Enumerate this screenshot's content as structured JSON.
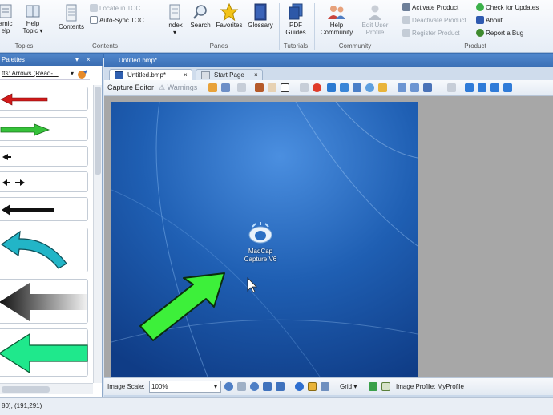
{
  "ribbon": {
    "topics_group": {
      "label": "Topics",
      "dynamic_help": "amic\nelp",
      "help_topic": "Help\nTopic ▾"
    },
    "contents_group": {
      "label": "Contents",
      "contents": "Contents",
      "locate_in_toc": "Locate in TOC",
      "auto_sync_toc": "Auto-Sync TOC"
    },
    "panes_group": {
      "label": "Panes",
      "index": "Index\n▾",
      "search": "Search",
      "favorites": "Favorites",
      "glossary": "Glossary"
    },
    "tutorials_group": {
      "label": "Tutorials",
      "pdf_guides": "PDF\nGuides"
    },
    "community_group": {
      "label": "Community",
      "help_community": "Help\nCommunity",
      "edit_user_profile": "Edit User\nProfile"
    },
    "product_group": {
      "label": "Product",
      "activate": "Activate Product",
      "deactivate": "Deactivate Product",
      "register": "Register Product",
      "check_updates": "Check for Updates",
      "about": "About",
      "report_bug": "Report a Bug"
    }
  },
  "palettes": {
    "title": "Palettes",
    "selector": "tts: Arrows (Read-...",
    "close_glyph": "×",
    "pin_glyph": "▾"
  },
  "document": {
    "window_title": "Untitled.bmp*",
    "tabs": [
      {
        "label": "Untitled.bmp*",
        "close": "×"
      },
      {
        "label": "Start Page",
        "close": "×"
      }
    ],
    "toolbar": {
      "capture_editor": "Capture Editor",
      "warnings": "Warnings"
    },
    "desktop_icon_label": "MadCap\nCapture V6",
    "bottom": {
      "image_scale_label": "Image Scale:",
      "image_scale_value": "100%",
      "grid": "Grid",
      "image_profile": "Image Profile: MyProfile"
    }
  },
  "status": {
    "coords": "80), (191,291)"
  },
  "colors": {
    "arrow_red": "#d11a1a",
    "arrow_green": "#36c23a",
    "arrow_teal": "#22b5c7",
    "arrow_mint": "#1fe88c",
    "desktop_blue": "#1f5fb3",
    "canvas_arrow": "#3df03a"
  }
}
